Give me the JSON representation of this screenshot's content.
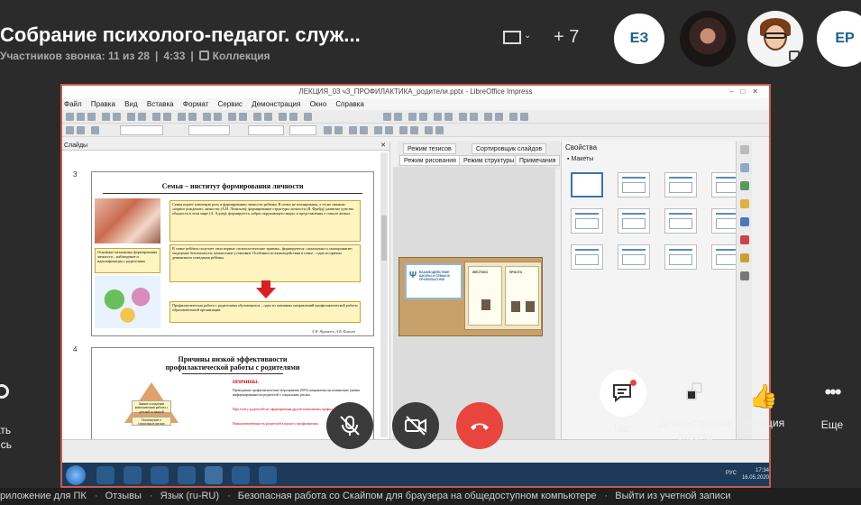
{
  "call": {
    "title": "Собрание психолого-педагог. служ...",
    "participants": "Участников звонка: 11 из 28",
    "duration": "4:33",
    "collection": "Коллекция"
  },
  "header": {
    "layout_chevron": "⌄",
    "add_people": "+ 7",
    "avatars": [
      {
        "initials": "ЕЗ"
      },
      {
        "initials": "ЕР"
      }
    ]
  },
  "screen": {
    "window_title": "ЛЕКЦИЯ_03 ч3_ПРОФИЛАКТИКА_родители.pptx - LibreOffice Impress",
    "menu": [
      "Файл",
      "Правка",
      "Вид",
      "Вставка",
      "Формат",
      "Сервис",
      "Демонстрация",
      "Окно",
      "Справка"
    ],
    "slides_pane_title": "Слайды",
    "slide3": {
      "number": "3",
      "title": "Семья – институт формирования личности",
      "box1": "Семья играет ключевую роль в формировании личности ребёнка. В семье не изолированы, а тесно связаны: «первое рождение» личности (А.Н. Леонтьев); формирование структуры личности (Я. Фрейд); развитие чувства общности в этом мире (А. Адлер); формируется «образ окружающего мира» и представления о смысле жизни.",
      "box2": "Основные механизмы формирования личности – наблюдение и идентификация с родителями",
      "box3": "В семье ребёнок получает свои первые «психологические травмы», формируются: самооценка и самопринятие; ощущение безопасности; ценностные установки. Особенности взаимодействия в семье – одна из причин девиантного поведения ребёнка.",
      "box4": "Профилактическая работа с родителями обучающихся – одно из значимых направлений профилактической работы образовательной организации.",
      "footer": "Л.Н. Журавлёв, А.В. Ковалёв"
    },
    "slide4": {
      "number": "4",
      "title": "Причины низкой эффективности профилактической работы с родителями",
      "reasons": "ПРИЧИНЫ:",
      "t1": "Проводимые профилактические мероприятия (90%) направлены на повышение уровня информированности родителей о социальных рисках.",
      "t2": "При этом у родителей не сформированы другие компоненты профилактической установки.",
      "t3": "Низкая вовлечённость родителей в процесс профилактики.",
      "pyr1": "Знание и владение компонентами работы с детской психикой",
      "pyr2": "Оповещение о социальных рисках"
    },
    "tabs": [
      "Режим тезисов",
      "Сортировщик слайдов",
      "Режим рисования",
      "Режим структуры",
      "Примечания"
    ],
    "props_title": "Свойства",
    "layouts_section": "Макеты",
    "board_text": "ВЗАИМОДЕЙСТВИЕ ШКОЛЫ И СЕМЬИ В ПРОФИЛАКТИКЕ",
    "booklet_p1": "ЖЕСТОКО",
    "booklet_p2": "ПРОСТО",
    "taskbar_lang": "РУС",
    "taskbar_time": "17:34",
    "taskbar_date": "16.05.2020"
  },
  "controls": {
    "chat": "Чат",
    "share": "Демонстрация экрана",
    "react": "Реакция",
    "more": "Еще",
    "left_1": "ать",
    "left_2": "ись"
  },
  "footer": {
    "links": [
      "риложение для ПК",
      "Отзывы",
      "Язык (ru-RU)",
      "Безопасная работа со Скайпом для браузера на общедоступном компьютере",
      "Выйти из учетной записи"
    ]
  }
}
